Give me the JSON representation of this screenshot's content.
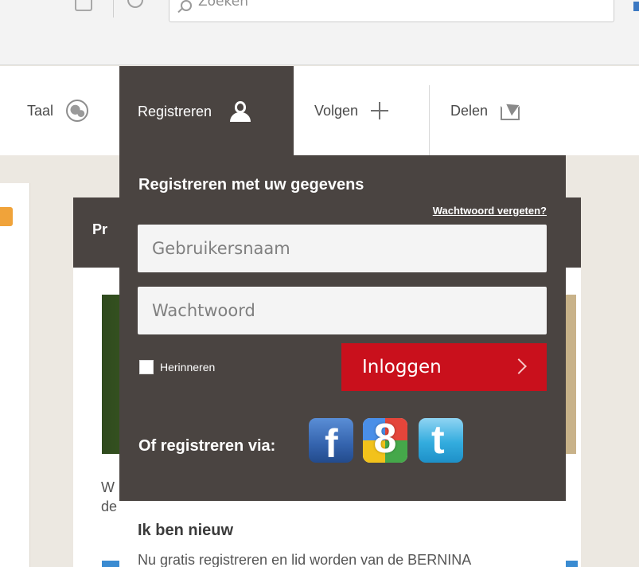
{
  "browser": {
    "search_placeholder": "Zoeken"
  },
  "nav": {
    "language_label": "Taal",
    "register_label": "Registreren",
    "follow_label": "Volgen",
    "share_label": "Delen"
  },
  "background": {
    "card_title_partial": "Pr",
    "card_text_partial": "W\nde"
  },
  "login_panel": {
    "title": "Registreren met uw gegevens",
    "forgot_password": "Wachtwoord vergeten?",
    "username_placeholder": "Gebruikersnaam",
    "password_placeholder": "Wachtwoord",
    "remember_label": "Herinneren",
    "remember_checked": false,
    "login_button": "Inloggen",
    "social_label": "Of registreren via:",
    "social_networks": [
      "facebook-icon",
      "google-icon",
      "twitter-icon"
    ],
    "new_title": "Ik ben nieuw",
    "new_text": "Nu gratis registreren en lid worden van de BERNINA"
  },
  "colors": {
    "panel_bg": "#4a4441",
    "login_button": "#c9101c",
    "page_bg": "#ece8e1"
  }
}
